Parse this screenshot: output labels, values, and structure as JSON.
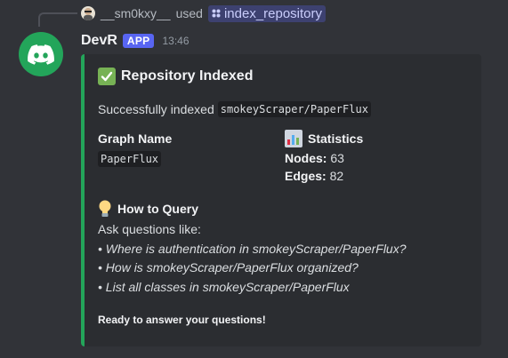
{
  "reply": {
    "username": "__sm0kxy__",
    "used_text": "used",
    "command": "index_repository"
  },
  "message": {
    "author": "DevR",
    "badge": "APP",
    "timestamp": "13:46"
  },
  "embed": {
    "accent_color": "#23a55a",
    "title": "Repository Indexed",
    "title_icon": "check-mark-button-emoji",
    "description_prefix": "Successfully indexed",
    "description_code": "smokeyScraper/PaperFlux",
    "fields": {
      "graph_name": {
        "name": "Graph Name",
        "value": "PaperFlux"
      },
      "statistics": {
        "name": "Statistics",
        "icon": "bar-chart-emoji",
        "nodes_label": "Nodes:",
        "nodes_value": "63",
        "edges_label": "Edges:",
        "edges_value": "82"
      },
      "how_to_query": {
        "name": "How to Query",
        "icon": "light-bulb-emoji",
        "intro": "Ask questions like:",
        "questions": [
          "• Where is authentication in smokeyScraper/PaperFlux?",
          "• How is smokeyScraper/PaperFlux organized?",
          "• List all classes in smokeyScraper/PaperFlux"
        ]
      }
    },
    "footer_note": "Ready to answer your questions!"
  }
}
